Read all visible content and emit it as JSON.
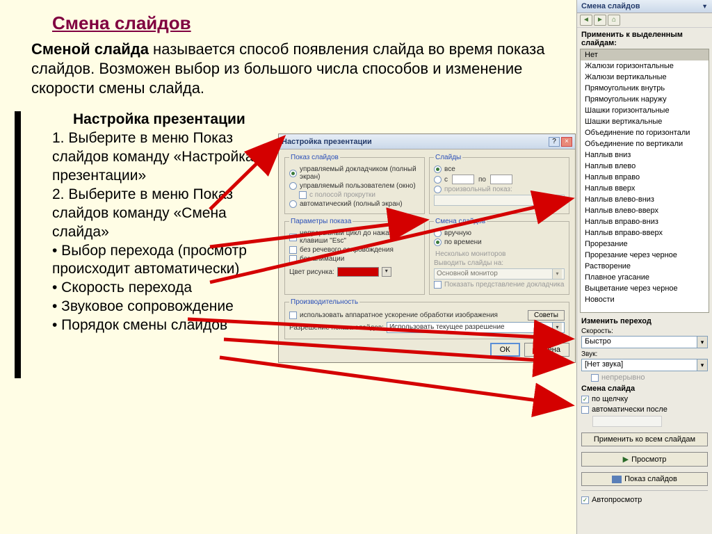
{
  "slide": {
    "title": "Смена слайдов",
    "desc_bold": "Сменой слайда",
    "desc_rest": " называется способ появления слайда во время показа слайдов. Возможен выбор из большого числа способов и изменение скорости смены слайда.",
    "instr_hdr": "Настройка презентации",
    "instr_lines": [
      "1. Выберите в меню Показ слайдов команду «Настройка презентации»",
      "2. Выберите в меню Показ слайдов команду «Смена слайда»",
      "• Выбор перехода (просмотр происходит автоматически)",
      "• Скорость перехода",
      "• Звуковое сопровождение",
      "• Порядок смены слайдов"
    ]
  },
  "dialog": {
    "title": "Настройка презентации",
    "g_show": "Показ слайдов",
    "show_opt1": "управляемый докладчиком (полный экран)",
    "show_opt2": "управляемый пользователем (окно)",
    "show_opt2a": "с полосой прокрутки",
    "show_opt3": "автоматический (полный экран)",
    "g_slides": "Слайды",
    "slides_all": "все",
    "slides_from": "с",
    "slides_to": "по",
    "slides_custom": "произвольный показ:",
    "g_params": "Параметры показа",
    "p1": "непрерывный цикл до нажатия клавиши \"Esc\"",
    "p2": "без речевого сопровождения",
    "p3": "без анимации",
    "color_lbl": "Цвет рисунка:",
    "g_change": "Смена слайдов",
    "ch1": "вручную",
    "ch2": "по времени",
    "g_mon": "Несколько мониторов",
    "mon_lbl": "Выводить слайды на:",
    "mon_val": "Основной монитор",
    "mon_chk": "Показать представление докладчика",
    "g_perf": "Производительность",
    "perf_chk": "использовать аппаратное ускорение обработки изображения",
    "perf_tips": "Советы",
    "res_lbl": "Разрешение показа слайдов:",
    "res_val": "Использовать текущее разрешение",
    "ok": "ОК",
    "cancel": "Отмена"
  },
  "pane": {
    "title": "Смена слайдов",
    "apply_lbl": "Применить к выделенным слайдам:",
    "items": [
      "Нет",
      "Жалюзи горизонтальные",
      "Жалюзи вертикальные",
      "Прямоугольник внутрь",
      "Прямоугольник наружу",
      "Шашки горизонтальные",
      "Шашки вертикальные",
      "Объединение по горизонтали",
      "Объединение по вертикали",
      "Наплыв вниз",
      "Наплыв влево",
      "Наплыв вправо",
      "Наплыв вверх",
      "Наплыв влево-вниз",
      "Наплыв влево-вверх",
      "Наплыв вправо-вниз",
      "Наплыв вправо-вверх",
      "Прорезание",
      "Прорезание через черное",
      "Растворение",
      "Плавное угасание",
      "Выцветание через черное",
      "Новости"
    ],
    "mod_hdr": "Изменить переход",
    "speed_lbl": "Скорость:",
    "speed_val": "Быстро",
    "sound_lbl": "Звук:",
    "sound_val": "[Нет звука]",
    "loop_lbl": "непрерывно",
    "adv_hdr": "Смена слайда",
    "adv1": "по щелчку",
    "adv2": "автоматически после",
    "btn_all": "Применить ко всем слайдам",
    "btn_play": "Просмотр",
    "btn_show": "Показ слайдов",
    "auto_prev": "Автопросмотр"
  }
}
